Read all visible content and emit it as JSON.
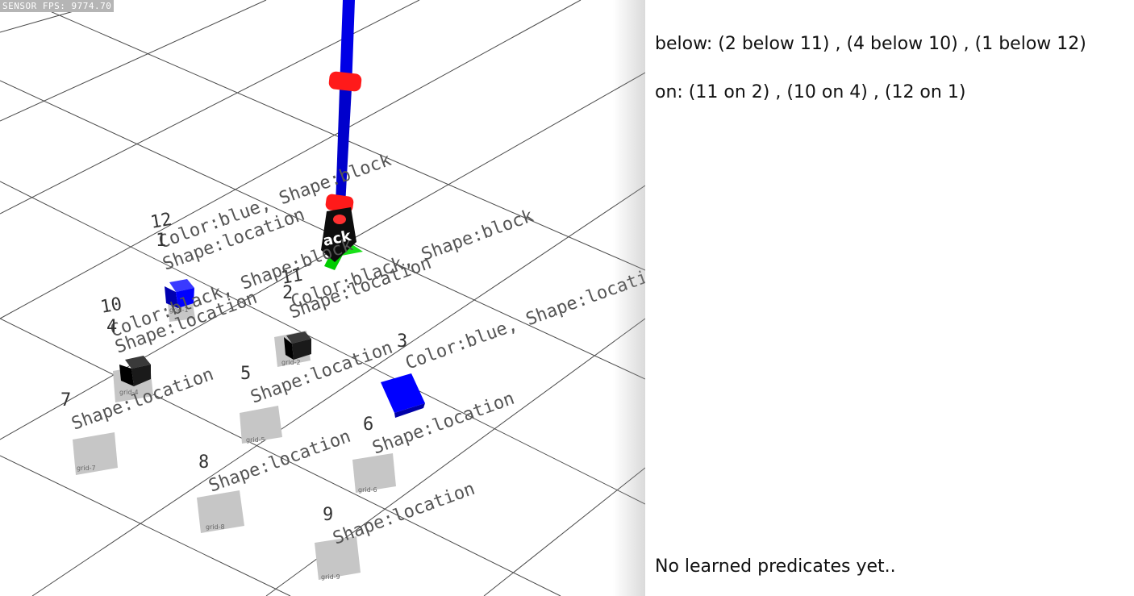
{
  "sensor_fps": "SENSOR FPS: 9774.70",
  "panel": {
    "below": "below: (2 below 11) , (4 below 10) , (1 below 12)",
    "on": "on: (11 on 2) , (10 on 4) , (12 on 1)",
    "learned": "No learned predicates yet.."
  },
  "objects": [
    {
      "id": "12",
      "text": "Color:blue, Shape:block"
    },
    {
      "id": "1",
      "text": "Shape:location"
    },
    {
      "id": "11",
      "text": "Color:black, Shape:block"
    },
    {
      "id": "2",
      "text": "Shape:location"
    },
    {
      "id": "10",
      "text": "Color:black, Shape:block"
    },
    {
      "id": "4",
      "text": "Shape:location"
    },
    {
      "id": "3",
      "text": "Color:blue, Shape:location"
    },
    {
      "id": "5",
      "text": "Shape:location"
    },
    {
      "id": "7",
      "text": "Shape:location"
    },
    {
      "id": "6",
      "text": "Shape:location"
    },
    {
      "id": "8",
      "text": "Shape:location"
    },
    {
      "id": "9",
      "text": "Shape:location"
    }
  ],
  "grid_tags": [
    "grid-1",
    "grid-2",
    "grid-4",
    "grid-5",
    "grid-6",
    "grid-7",
    "grid-8",
    "grid-9"
  ],
  "held_label": "ack",
  "colors": {
    "blue": "#0000ff",
    "black": "#111111",
    "gripper": "#ff1a1a",
    "arm": "#0000e6",
    "location": "#c6c6c6"
  }
}
